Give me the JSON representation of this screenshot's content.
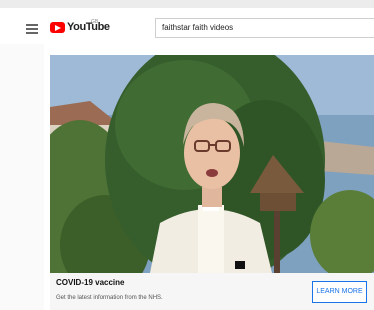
{
  "header": {
    "logo_text": "YouTube",
    "logo_region": "GB",
    "search_value": "faithstar faith videos"
  },
  "video": {
    "description": "Woman in white clerical robe speaking outdoors in a garden with a tall hedge"
  },
  "ad": {
    "title": "COVID-19 vaccine",
    "subtitle": "Get the latest information from the NHS.",
    "button_label": "LEARN MORE"
  },
  "colors": {
    "brand_red": "#ff0000",
    "link_blue": "#1a73e8"
  }
}
